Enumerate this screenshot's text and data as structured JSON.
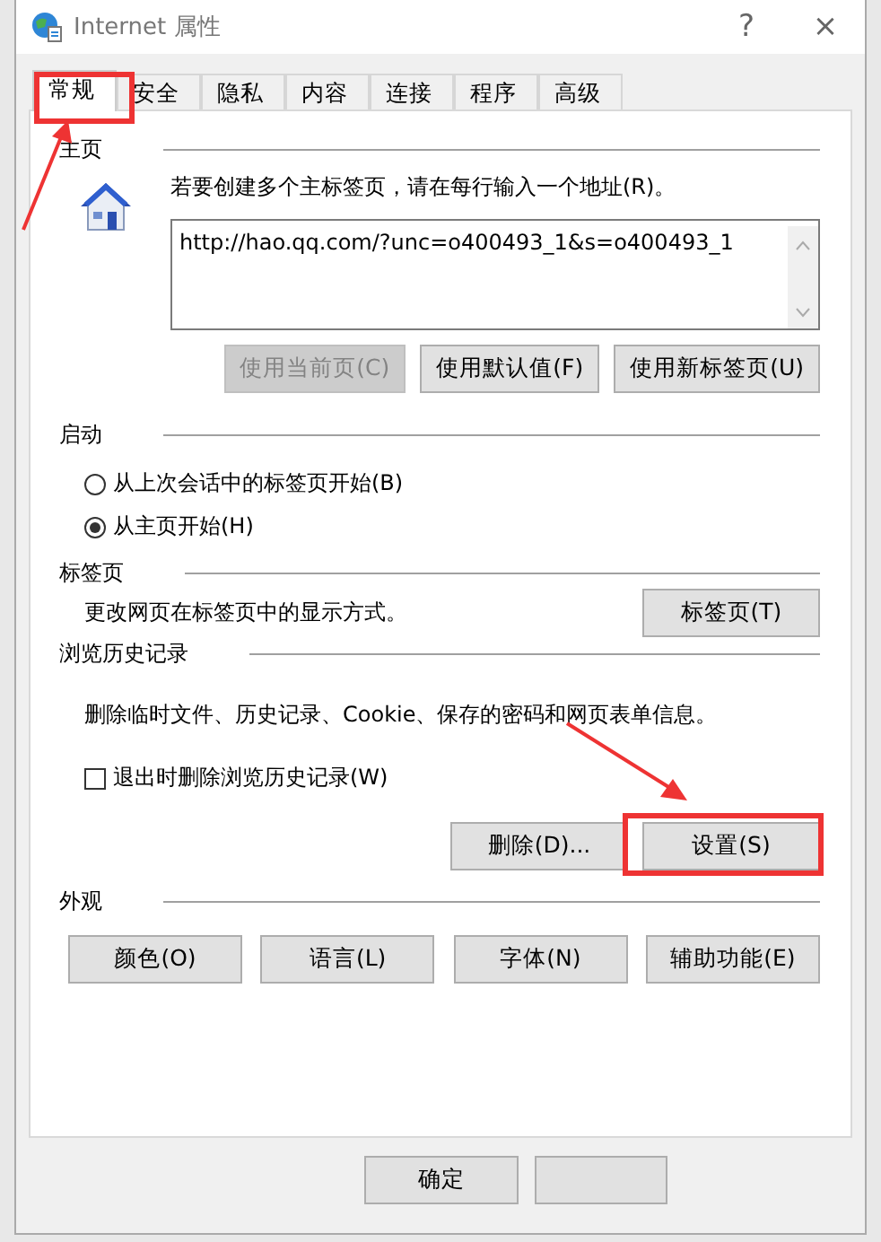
{
  "window": {
    "title": "Internet 属性",
    "help": "?",
    "close": "×"
  },
  "tabs": [
    {
      "label": "常规",
      "selected": true
    },
    {
      "label": "安全",
      "selected": false
    },
    {
      "label": "隐私",
      "selected": false
    },
    {
      "label": "内容",
      "selected": false
    },
    {
      "label": "连接",
      "selected": false
    },
    {
      "label": "程序",
      "selected": false
    },
    {
      "label": "高级",
      "selected": false
    }
  ],
  "homepage": {
    "heading": "主页",
    "hint": "若要创建多个主标签页，请在每行输入一个地址(R)。",
    "value": "http://hao.qq.com/?unc=o400493_1&s=o400493_1",
    "buttons": [
      {
        "label": "使用当前页(C)",
        "disabled": true
      },
      {
        "label": "使用默认值(F)",
        "disabled": false
      },
      {
        "label": "使用新标签页(U)",
        "disabled": false
      }
    ]
  },
  "startup": {
    "heading": "启动",
    "options": [
      {
        "label": "从上次会话中的标签页开始(B)",
        "selected": false
      },
      {
        "label": "从主页开始(H)",
        "selected": true
      }
    ]
  },
  "tabs_section": {
    "heading": "标签页",
    "text": "更改网页在标签页中的显示方式。",
    "button": "标签页(T)"
  },
  "history": {
    "heading": "浏览历史记录",
    "text": "删除临时文件、历史记录、Cookie、保存的密码和网页表单信息。",
    "checkbox": {
      "label": "退出时删除浏览历史记录(W)",
      "checked": false
    },
    "buttons": [
      "删除(D)...",
      "设置(S)"
    ]
  },
  "appearance": {
    "heading": "外观",
    "buttons": [
      "颜色(O)",
      "语言(L)",
      "字体(N)",
      "辅助功能(E)"
    ]
  },
  "footer_buttons": [
    "确定"
  ]
}
